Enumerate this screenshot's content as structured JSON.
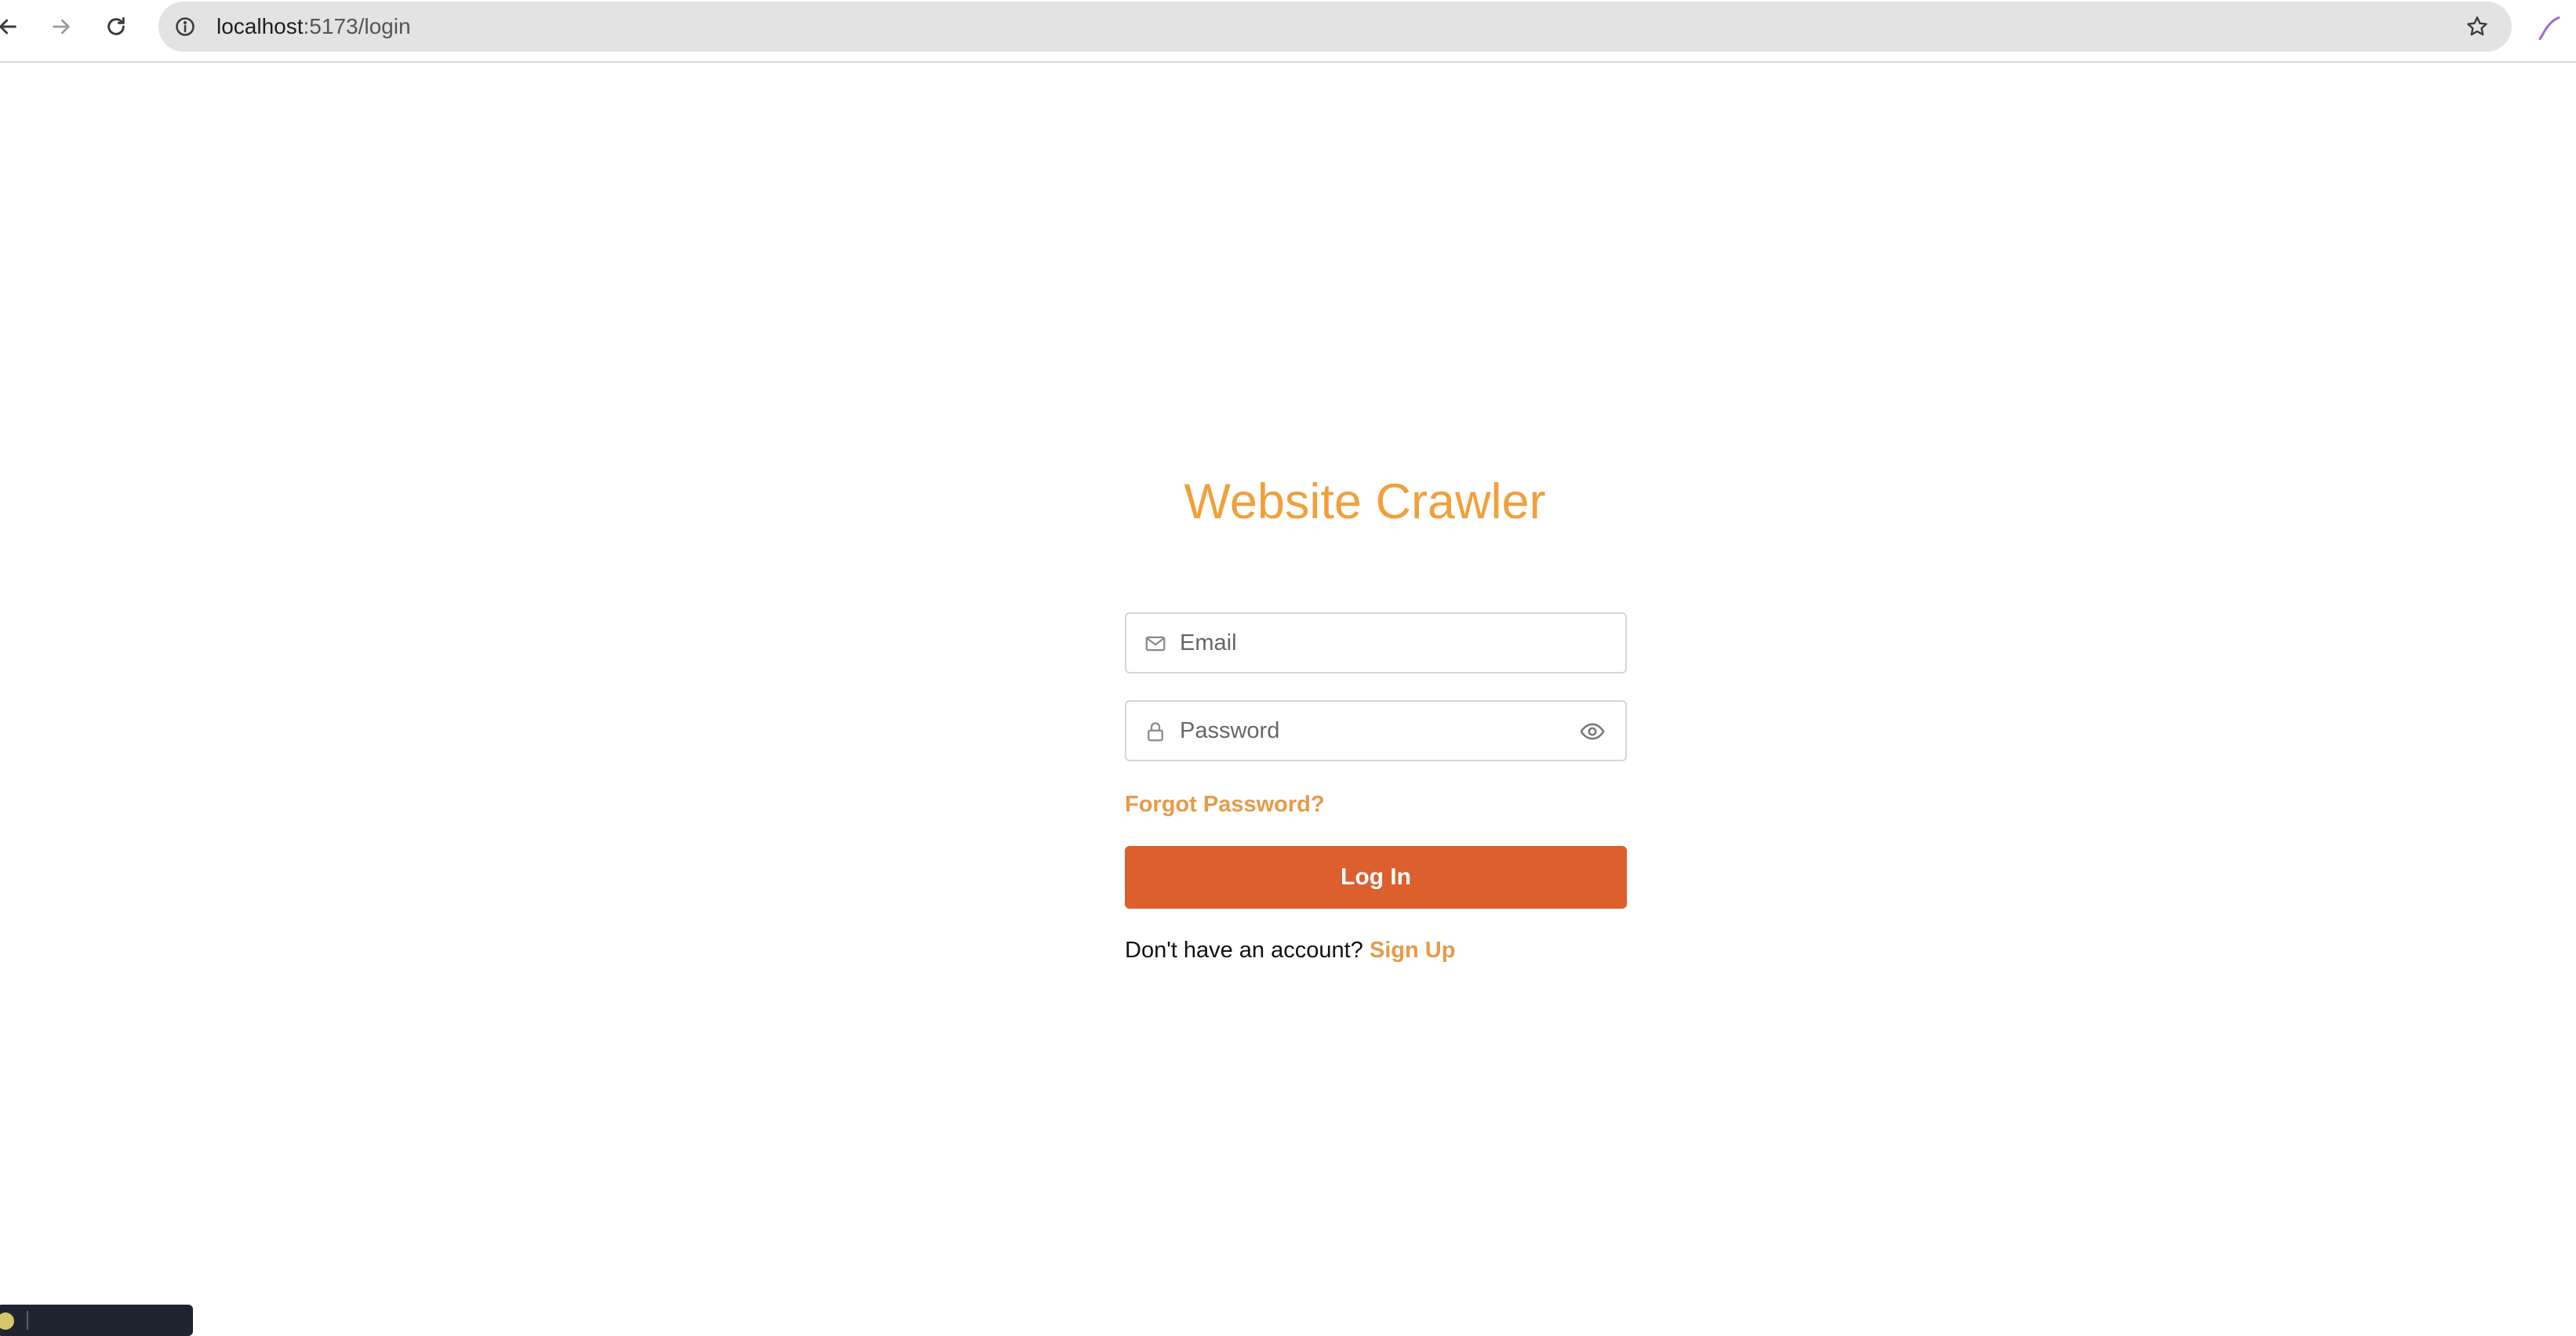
{
  "browser": {
    "url_host": "localhost",
    "url_path": ":5173/login"
  },
  "page": {
    "title": "Website Crawler",
    "email_placeholder": "Email",
    "password_placeholder": "Password",
    "forgot_password_label": "Forgot Password?",
    "login_button_label": "Log In",
    "signup_prompt": "Don't have an account?",
    "signup_link_label": "Sign Up"
  },
  "icons": {
    "back": "arrow-left-icon",
    "forward": "arrow-right-icon",
    "reload": "reload-icon",
    "site_info": "info-icon",
    "bookmark": "star-icon",
    "extension": "feather-pen-icon",
    "email_field": "mail-icon",
    "password_field": "lock-icon",
    "show_password": "eye-icon"
  },
  "colors": {
    "title": "#f0a03c",
    "accent_link": "#e89a4a",
    "primary_button": "#dc5f2e"
  }
}
